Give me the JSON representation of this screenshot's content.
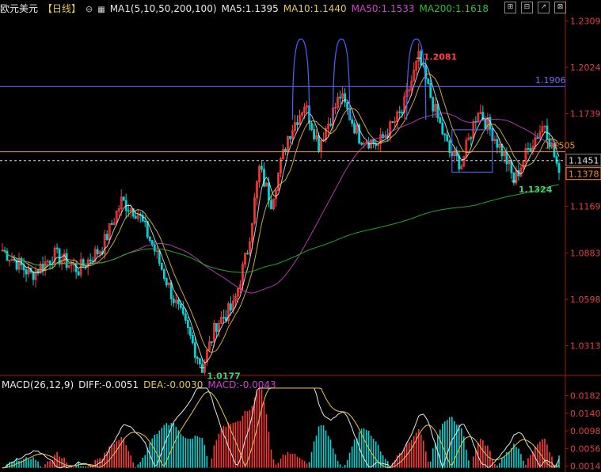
{
  "header": {
    "symbol": "欧元美元",
    "period": "【日线】",
    "gear_icon": "⊖",
    "ma_icon": "chart-icon",
    "ma_label": "MA1(5,10,50,200,100)",
    "ma5": "MA5:1.1395",
    "ma10": "MA10:1.1440",
    "ma50": "MA50:1.1533",
    "ma200": "MA200:1.1618"
  },
  "window_buttons": [
    "⊞",
    "⊟",
    "↗",
    "⊠"
  ],
  "macd_header": {
    "label": "MACD(26,12,9)",
    "diff": "DIFF:-0.0051",
    "dea": "DEA:-0.0030",
    "macd": "MACD:-0.0043"
  },
  "colors": {
    "ma5": "#e8e8e8",
    "ma10": "#e5c84b",
    "ma50": "#d040d0",
    "ma200": "#30c030",
    "up": "#ff3a3a",
    "down": "#00d4d4",
    "axis_text": "#e04040"
  },
  "chart_data": {
    "type": "line",
    "price_axis": {
      "ylim": [
        1.015,
        1.235
      ],
      "ticks": [
        "1.2309",
        "1.2024",
        "1.1739",
        "1.1454",
        "1.1169",
        "1.0883",
        "1.0598",
        "1.0313"
      ]
    },
    "levels": [
      {
        "value": 1.1906,
        "label": "1.1906",
        "color": "#6f6fff"
      },
      {
        "value": 1.1505,
        "label": "1.1505",
        "color": "#ff8c2a"
      },
      {
        "value": 1.1451,
        "label": "1.1451",
        "color": "#e0e0e0"
      },
      {
        "value": 1.1378,
        "label": "1.1378",
        "color": "#ff8c2a"
      }
    ],
    "annotations": [
      {
        "value": 1.2081,
        "label": "1.2081",
        "color": "#ff4040"
      },
      {
        "value": 1.1324,
        "label": "1.1324",
        "color": "#40d070"
      },
      {
        "value": 1.0177,
        "label": "1.0177",
        "color": "#40d070"
      }
    ],
    "anchors": [
      {
        "i": 0,
        "p": 1.09
      },
      {
        "i": 12,
        "p": 1.075
      },
      {
        "i": 22,
        "p": 1.087
      },
      {
        "i": 32,
        "p": 1.078
      },
      {
        "i": 42,
        "p": 1.092
      },
      {
        "i": 50,
        "p": 1.12
      },
      {
        "i": 57,
        "p": 1.113
      },
      {
        "i": 64,
        "p": 1.09
      },
      {
        "i": 72,
        "p": 1.06
      },
      {
        "i": 78,
        "p": 1.04
      },
      {
        "i": 84,
        "p": 1.0177
      },
      {
        "i": 90,
        "p": 1.045
      },
      {
        "i": 97,
        "p": 1.055
      },
      {
        "i": 103,
        "p": 1.09
      },
      {
        "i": 108,
        "p": 1.14
      },
      {
        "i": 113,
        "p": 1.12
      },
      {
        "i": 120,
        "p": 1.16
      },
      {
        "i": 127,
        "p": 1.18
      },
      {
        "i": 133,
        "p": 1.155
      },
      {
        "i": 142,
        "p": 1.185
      },
      {
        "i": 150,
        "p": 1.16
      },
      {
        "i": 158,
        "p": 1.155
      },
      {
        "i": 168,
        "p": 1.175
      },
      {
        "i": 175,
        "p": 1.2081
      },
      {
        "i": 182,
        "p": 1.175
      },
      {
        "i": 188,
        "p": 1.15
      },
      {
        "i": 193,
        "p": 1.143
      },
      {
        "i": 200,
        "p": 1.177
      },
      {
        "i": 206,
        "p": 1.162
      },
      {
        "i": 212,
        "p": 1.145
      },
      {
        "i": 215,
        "p": 1.1324
      },
      {
        "i": 222,
        "p": 1.155
      },
      {
        "i": 228,
        "p": 1.168
      },
      {
        "i": 234,
        "p": 1.1378
      }
    ],
    "bar_count": 235,
    "macd_axis": {
      "ylim": [
        0.0,
        0.02
      ],
      "ticks": [
        "0.0182",
        "0.0140",
        "0.0098",
        "0.0056",
        "0.0014"
      ]
    }
  }
}
